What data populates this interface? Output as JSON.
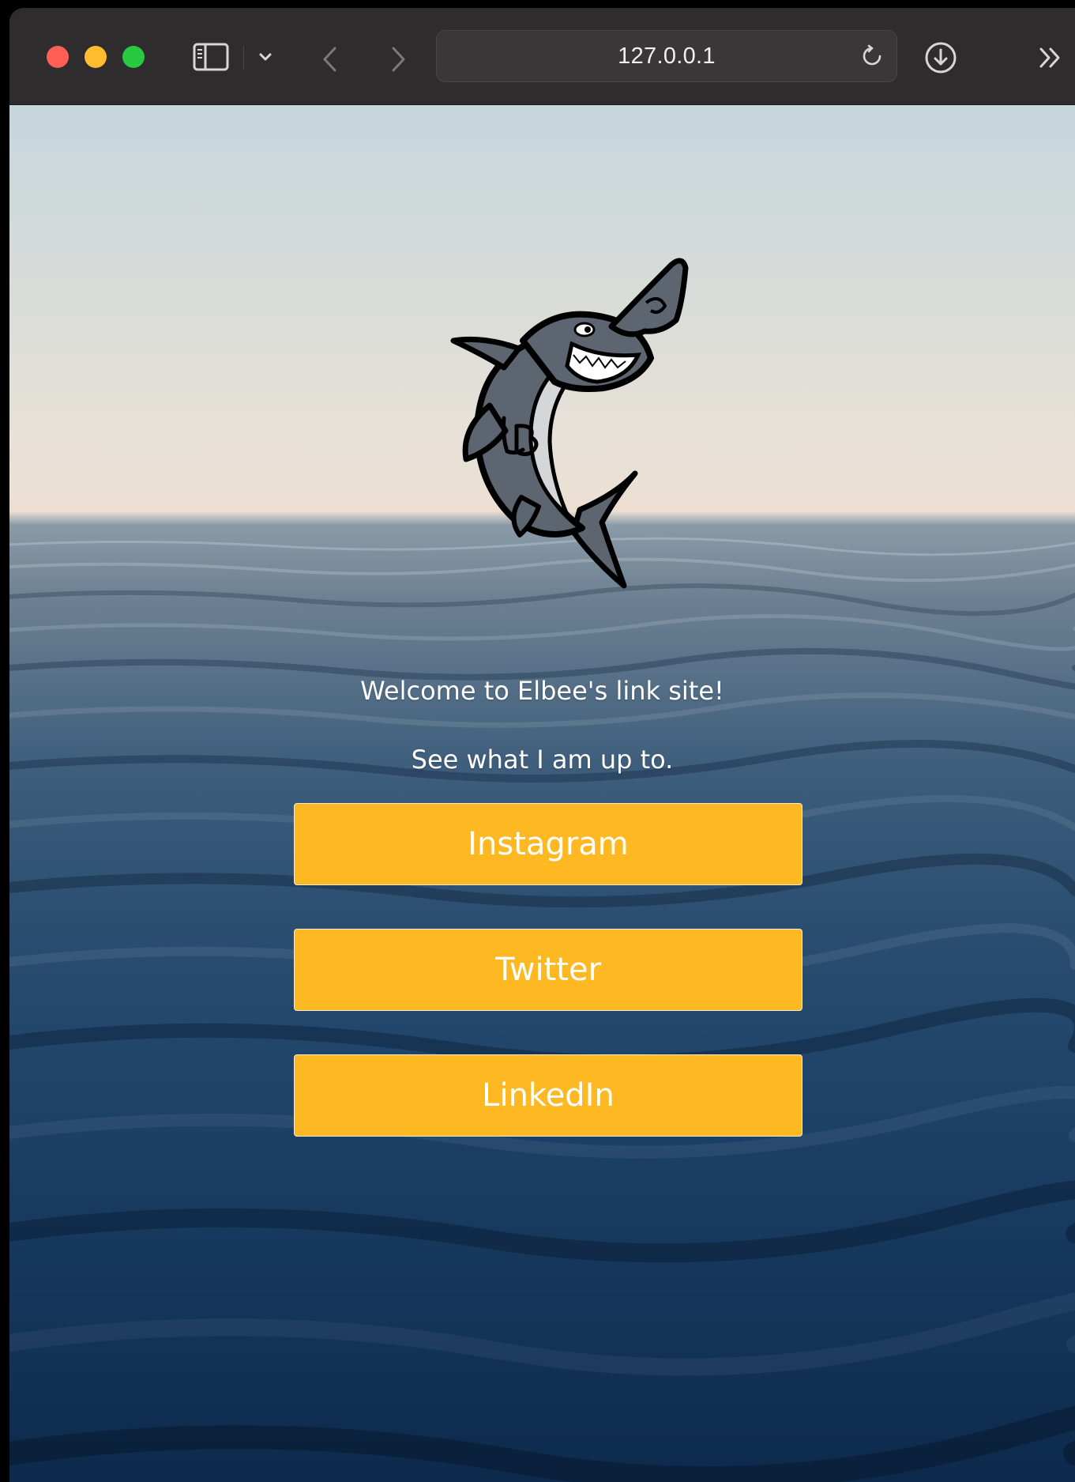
{
  "browser": {
    "address": "127.0.0.1",
    "icons": [
      "sidebar-icon",
      "chevron-down-icon",
      "back-icon",
      "forward-icon",
      "reload-icon",
      "download-icon",
      "more-chevrons-icon"
    ]
  },
  "page": {
    "logo_icon": "shark-mascot-logo",
    "welcome": "Welcome to Elbee's link site!",
    "tagline": "See what I am up to.",
    "links": [
      "Instagram",
      "Twitter",
      "LinkedIn"
    ]
  },
  "colors": {
    "button": "#fdb822",
    "button_text": "#ffffff",
    "toolbar": "#2f2c2e",
    "close": "#fe5f57",
    "minimize": "#febc2e",
    "zoom": "#28c840"
  }
}
